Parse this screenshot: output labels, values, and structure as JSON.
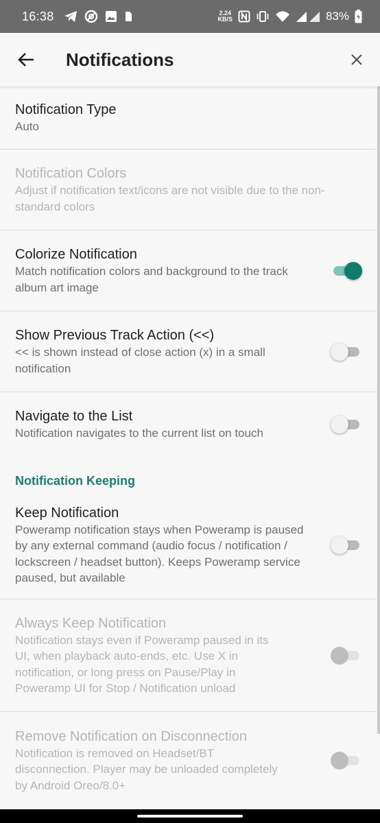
{
  "status_bar": {
    "time": "16:38",
    "speed_value": "2.24",
    "speed_unit": "KB/S",
    "battery_percent": "83%",
    "icons_left": [
      "telegram-icon",
      "at-sign-icon",
      "image-icon",
      "sim-icon"
    ],
    "icons_right": [
      "nfc-icon",
      "vibrate-icon",
      "wifi-icon",
      "signal-icon",
      "battery-icon"
    ]
  },
  "app_bar": {
    "title": "Notifications",
    "back_icon": "arrow-left-icon",
    "close_icon": "close-icon"
  },
  "colors": {
    "accent": "#0e7d6c",
    "accent_track": "#7ec4b8",
    "section_header": "#1a7f70",
    "status_bar": "#6b6b6b",
    "background": "#f7f7f7"
  },
  "preferences": [
    {
      "title": "Notification Type",
      "summary": "Auto",
      "enabled": true,
      "has_toggle": false
    },
    {
      "title": "Notification Colors",
      "summary": "Adjust if notification text/icons are not visible due to the non-standard colors",
      "enabled": false,
      "has_toggle": false
    },
    {
      "title": "Colorize Notification",
      "summary": "Match notification colors and background to the track album art image",
      "enabled": true,
      "has_toggle": true,
      "checked": true
    },
    {
      "title": "Show Previous Track Action (<<)",
      "summary": "<< is shown instead of close action (x) in a small notification",
      "enabled": true,
      "has_toggle": true,
      "checked": false
    },
    {
      "title": "Navigate to the List",
      "summary": "Notification navigates to the current list on touch",
      "enabled": true,
      "has_toggle": true,
      "checked": false
    }
  ],
  "section": {
    "title": "Notification Keeping",
    "items": [
      {
        "title": "Keep Notification",
        "summary": "Poweramp notification stays when Poweramp is paused by any external command (audio focus / notification / lockscreen / headset button). Keeps Poweramp service paused, but available",
        "enabled": true,
        "has_toggle": true,
        "checked": false
      },
      {
        "title": "Always Keep Notification",
        "summary": "Notification stays even if Poweramp paused in its UI, when playback auto-ends, etc. Use X in notification, or long press on Pause/Play in Poweramp UI for Stop / Notification unload",
        "enabled": false,
        "has_toggle": true,
        "checked": false
      },
      {
        "title": "Remove Notification on Disconnection",
        "summary": "Notification is removed on Headset/BT disconnection. Player may be unloaded completely by Android Oreo/8.0+",
        "enabled": false,
        "has_toggle": true,
        "checked": false
      }
    ]
  }
}
